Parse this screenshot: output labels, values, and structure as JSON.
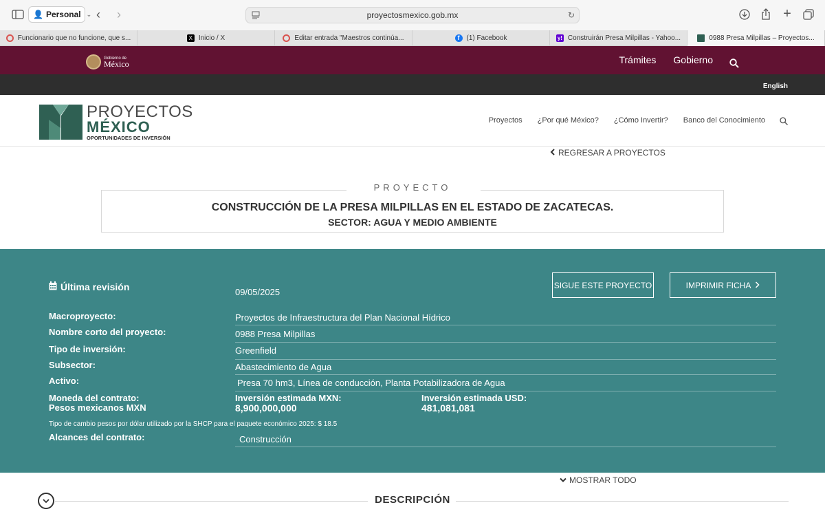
{
  "browser": {
    "profile": "Personal",
    "url": "proyectosmexico.gob.mx",
    "tabs": [
      {
        "label": "Funcionario que no funcione, que s...",
        "icon": "circle-icon",
        "active": false
      },
      {
        "label": "Inicio / X",
        "icon": "x-icon",
        "active": false
      },
      {
        "label": "Editar entrada \"Maestros continúa...",
        "icon": "circle-icon",
        "active": false
      },
      {
        "label": "(1) Facebook",
        "icon": "facebook-icon",
        "active": false
      },
      {
        "label": "Construirán Presa Milpillas - Yahoo...",
        "icon": "yahoo-icon",
        "active": false
      },
      {
        "label": "0988 Presa Milpillas – Proyectos...",
        "icon": "proyectos-icon",
        "active": true
      }
    ]
  },
  "gov": {
    "logo_small": "Gobierno de",
    "logo_big": "México",
    "nav": [
      "Trámites",
      "Gobierno"
    ],
    "lang": "English"
  },
  "site": {
    "logo_line1": "PROYECTOS",
    "logo_line2": "MÉXICO",
    "logo_line3": "OPORTUNIDADES DE INVERSIÓN",
    "nav": [
      "Proyectos",
      "¿Por qué México?",
      "¿Cómo Invertir?",
      "Banco del Conocimiento"
    ],
    "back_link": "REGRESAR A PROYECTOS"
  },
  "project": {
    "label": "PROYECTO",
    "title": "CONSTRUCCIÓN DE LA PRESA MILPILLAS EN EL ESTADO DE ZACATECAS.",
    "sector": "SECTOR: AGUA Y MEDIO AMBIENTE"
  },
  "details": {
    "last_review_label": "Última revisión",
    "last_review_value": "09/05/2025",
    "follow_button": "SIGUE ESTE PROYECTO",
    "print_button": "IMPRIMIR FICHA",
    "macro_label": "Macroproyecto:",
    "macro_value": "Proyectos de Infraestructura del Plan Nacional Hídrico",
    "short_name_label": "Nombre corto del proyecto:",
    "short_name_value": "0988 Presa Milpillas",
    "investment_type_label": "Tipo de inversión:",
    "investment_type_value": "Greenfield",
    "subsector_label": "Subsector:",
    "subsector_value": "Abastecimiento de Agua",
    "asset_label": "Activo:",
    "asset_value": "Presa 70 hm3, Línea de conducción, Planta Potabilizadora de Agua",
    "currency_label": "Moneda del contrato:",
    "currency_value": "Pesos mexicanos MXN",
    "inv_mxn_label": "Inversión estimada MXN:",
    "inv_mxn_value": "8,900,000,000",
    "inv_usd_label": "Inversión estimada USD:",
    "inv_usd_value": "481,081,081",
    "exchange_note": "Tipo de cambio pesos por dólar utilizado por la SHCP para el paquete económico 2025: $ 18.5",
    "scope_label": "Alcances del contrato:",
    "scope_value": "Construcción"
  },
  "show_all": "MOSTRAR TODO",
  "description_title": "DESCRIPCIÓN",
  "colors": {
    "gov_bar": "#611232",
    "panel": "#3d8687",
    "logo_green": "#2f6053"
  }
}
